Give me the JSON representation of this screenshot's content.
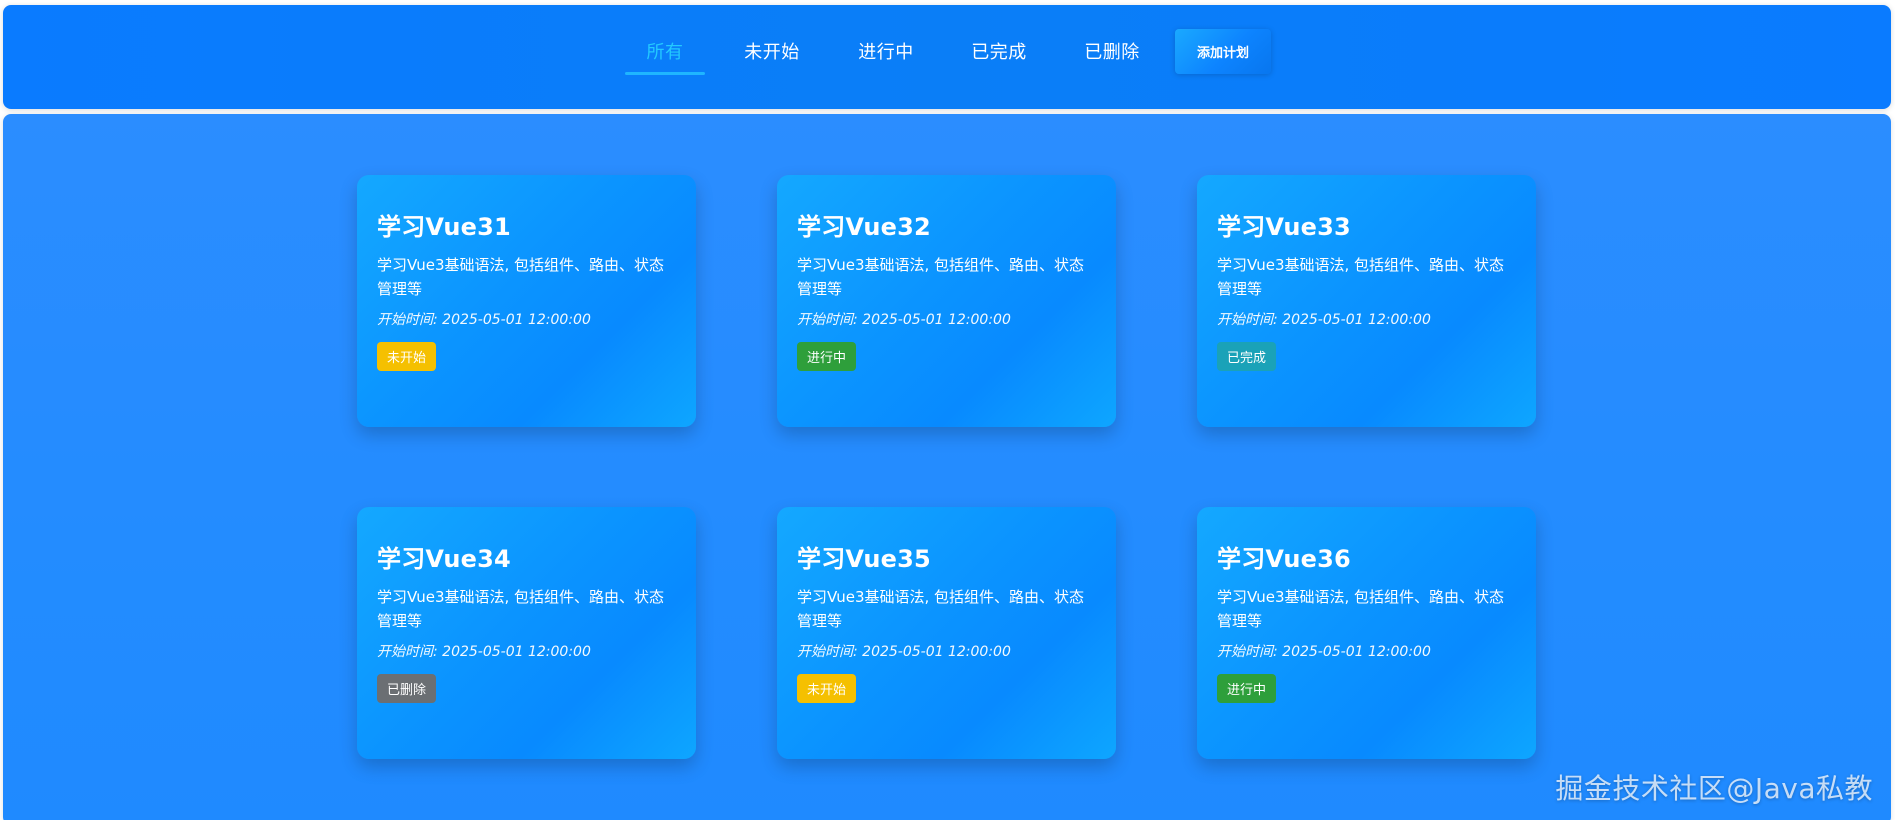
{
  "nav": {
    "tabs": [
      {
        "label": "所有",
        "active": true
      },
      {
        "label": "未开始",
        "active": false
      },
      {
        "label": "进行中",
        "active": false
      },
      {
        "label": "已完成",
        "active": false
      },
      {
        "label": "已删除",
        "active": false
      }
    ],
    "add_button_label": "添加计划"
  },
  "colors": {
    "active_tab": "#23c9ff",
    "status_not_started": "#f5c000",
    "status_in_progress": "#2e9f3b",
    "status_completed": "#1aa2b8",
    "status_deleted": "#6b6f73"
  },
  "plans": [
    {
      "title": "学习Vue31",
      "desc": "学习Vue3基础语法, 包括组件、路由、状态管理等",
      "time": "开始时间: 2025-05-01 12:00:00",
      "status": "未开始",
      "status_color": "#f5c000"
    },
    {
      "title": "学习Vue32",
      "desc": "学习Vue3基础语法, 包括组件、路由、状态管理等",
      "time": "开始时间: 2025-05-01 12:00:00",
      "status": "进行中",
      "status_color": "#2e9f3b"
    },
    {
      "title": "学习Vue33",
      "desc": "学习Vue3基础语法, 包括组件、路由、状态管理等",
      "time": "开始时间: 2025-05-01 12:00:00",
      "status": "已完成",
      "status_color": "#1aa2b8"
    },
    {
      "title": "学习Vue34",
      "desc": "学习Vue3基础语法, 包括组件、路由、状态管理等",
      "time": "开始时间: 2025-05-01 12:00:00",
      "status": "已删除",
      "status_color": "#6b6f73"
    },
    {
      "title": "学习Vue35",
      "desc": "学习Vue3基础语法, 包括组件、路由、状态管理等",
      "time": "开始时间: 2025-05-01 12:00:00",
      "status": "未开始",
      "status_color": "#f5c000"
    },
    {
      "title": "学习Vue36",
      "desc": "学习Vue3基础语法, 包括组件、路由、状态管理等",
      "time": "开始时间: 2025-05-01 12:00:00",
      "status": "进行中",
      "status_color": "#2e9f3b"
    }
  ],
  "watermark": "掘金技术社区@Java私教"
}
